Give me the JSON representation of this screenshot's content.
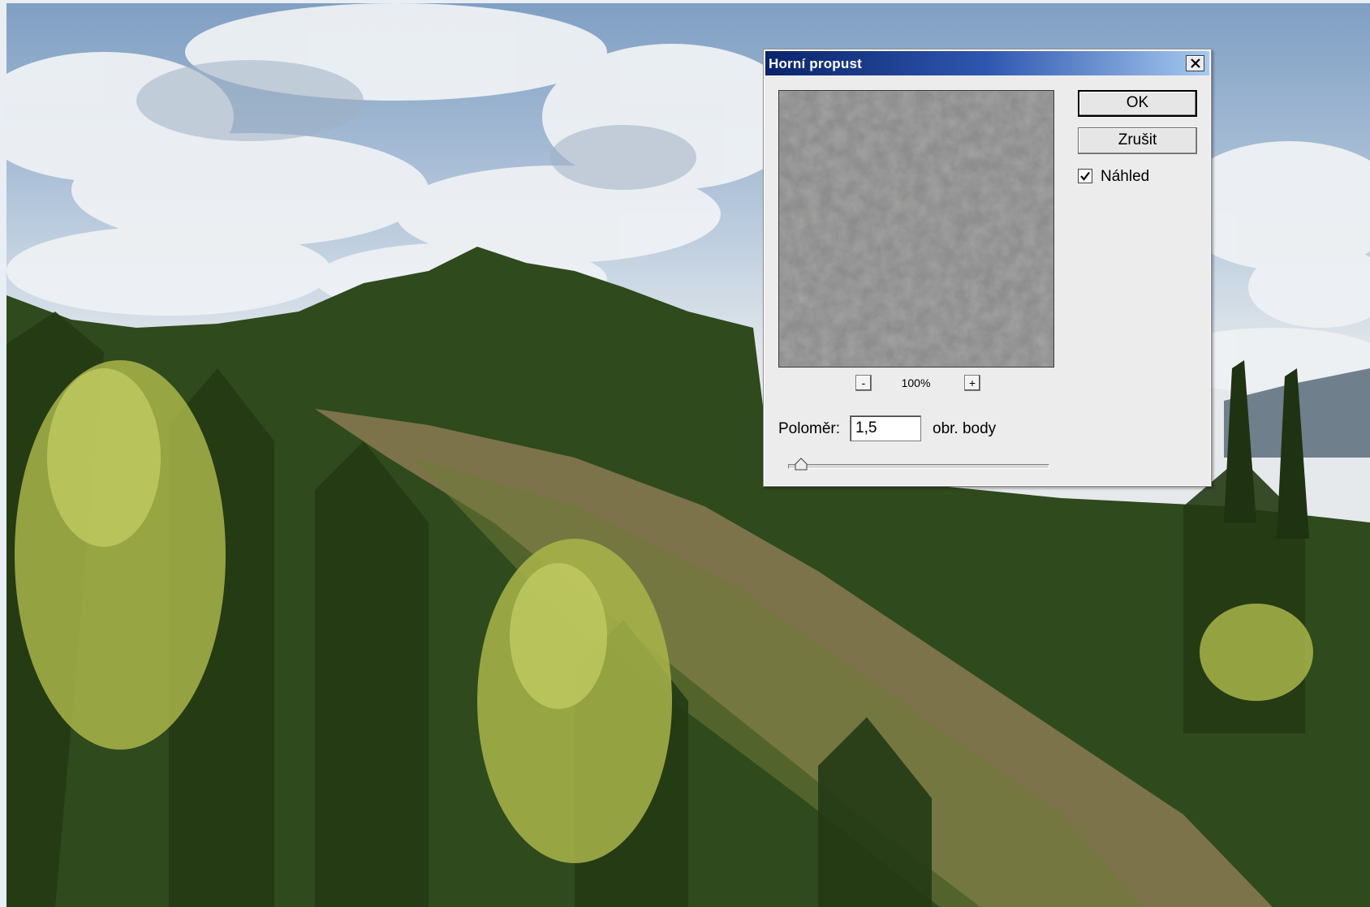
{
  "dialog": {
    "title": "Horní propust",
    "close_icon": "close-icon",
    "zoom_out_label": "-",
    "zoom_in_label": "+",
    "zoom_level": "100%",
    "radius_label": "Poloměr:",
    "radius_value": "1,5",
    "radius_unit": "obr. body",
    "slider_fraction": 0.05,
    "ok_label": "OK",
    "cancel_label": "Zrušit",
    "preview_label": "Náhled",
    "preview_checked": true
  },
  "colors": {
    "titlebar_start": "#0a246a",
    "titlebar_end": "#a6caf0",
    "dialog_bg": "#ececec",
    "preview_gray": "#8e8e8e"
  }
}
